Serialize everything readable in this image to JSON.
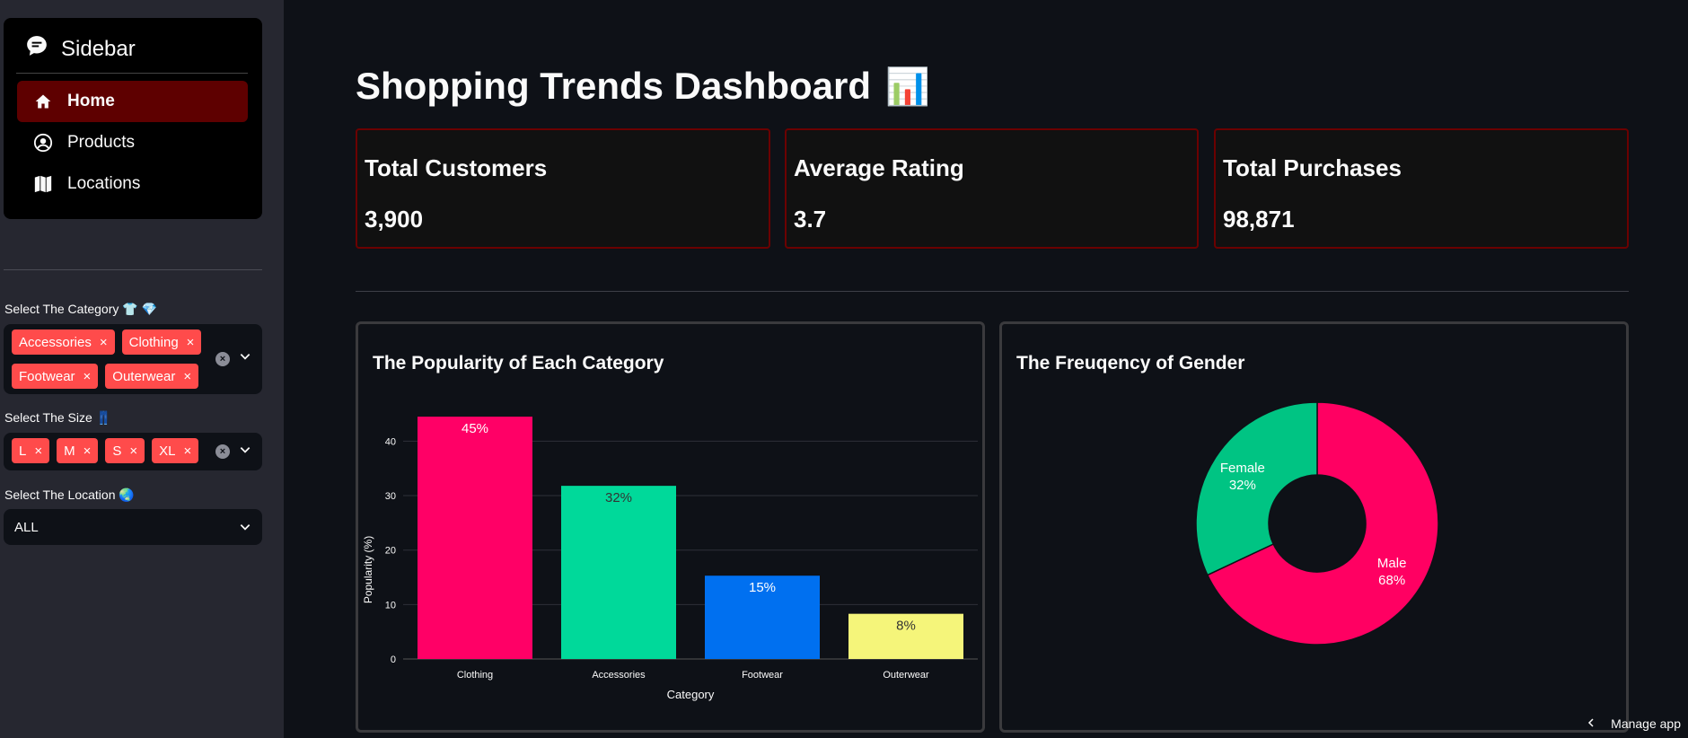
{
  "sidebar": {
    "header": {
      "icon": "chat-bubble-icon",
      "title": "Sidebar"
    },
    "items": [
      {
        "label": "Home",
        "icon": "home-icon",
        "active": true
      },
      {
        "label": "Products",
        "icon": "user-circle-icon",
        "active": false
      },
      {
        "label": "Locations",
        "icon": "map-icon",
        "active": false
      }
    ],
    "category": {
      "label": "Select The Category 👕 💎",
      "tags": [
        "Accessories",
        "Clothing",
        "Footwear",
        "Outerwear"
      ]
    },
    "size": {
      "label": "Select The Size 👖",
      "tags": [
        "L",
        "M",
        "S",
        "XL"
      ]
    },
    "location": {
      "label": "Select The Location 🌏",
      "value": "ALL"
    }
  },
  "main": {
    "title": "Shopping Trends Dashboard",
    "title_emoji": "📊",
    "metrics": [
      {
        "label": "Total Customers",
        "value": "3,900"
      },
      {
        "label": "Average Rating",
        "value": "3.7"
      },
      {
        "label": "Total Purchases",
        "value": "98,871"
      }
    ]
  },
  "footer": {
    "manage_label": "Manage app"
  },
  "colors": {
    "accent": "#ff4b4b",
    "active_nav": "#5e0000",
    "metric_border": "#6b0000"
  },
  "chart_data": [
    {
      "type": "bar",
      "title": "The Popularity of Each Category",
      "xlabel": "Category",
      "ylabel": "Popularity (%)",
      "categories": [
        "Clothing",
        "Accessories",
        "Footwear",
        "Outerwear"
      ],
      "values": [
        44.5,
        31.8,
        15.3,
        8.3
      ],
      "labels": [
        "45%",
        "32%",
        "15%",
        "8%"
      ],
      "colors": [
        "#ff0066",
        "#00d99a",
        "#0070f0",
        "#f5f57a"
      ],
      "label_colors": [
        "#ffffff",
        "#333333",
        "#ffffff",
        "#333333"
      ],
      "yticks": [
        0,
        10,
        20,
        30,
        40
      ],
      "ylim": [
        0,
        46
      ],
      "grid": true
    },
    {
      "type": "pie",
      "title": "The Freuqency of Gender",
      "hole": 0.4,
      "slices": [
        {
          "label": "Male",
          "value": 68,
          "text": "68%",
          "color": "#ff0062"
        },
        {
          "label": "Female",
          "value": 32,
          "text": "32%",
          "color": "#00c483"
        }
      ]
    }
  ]
}
